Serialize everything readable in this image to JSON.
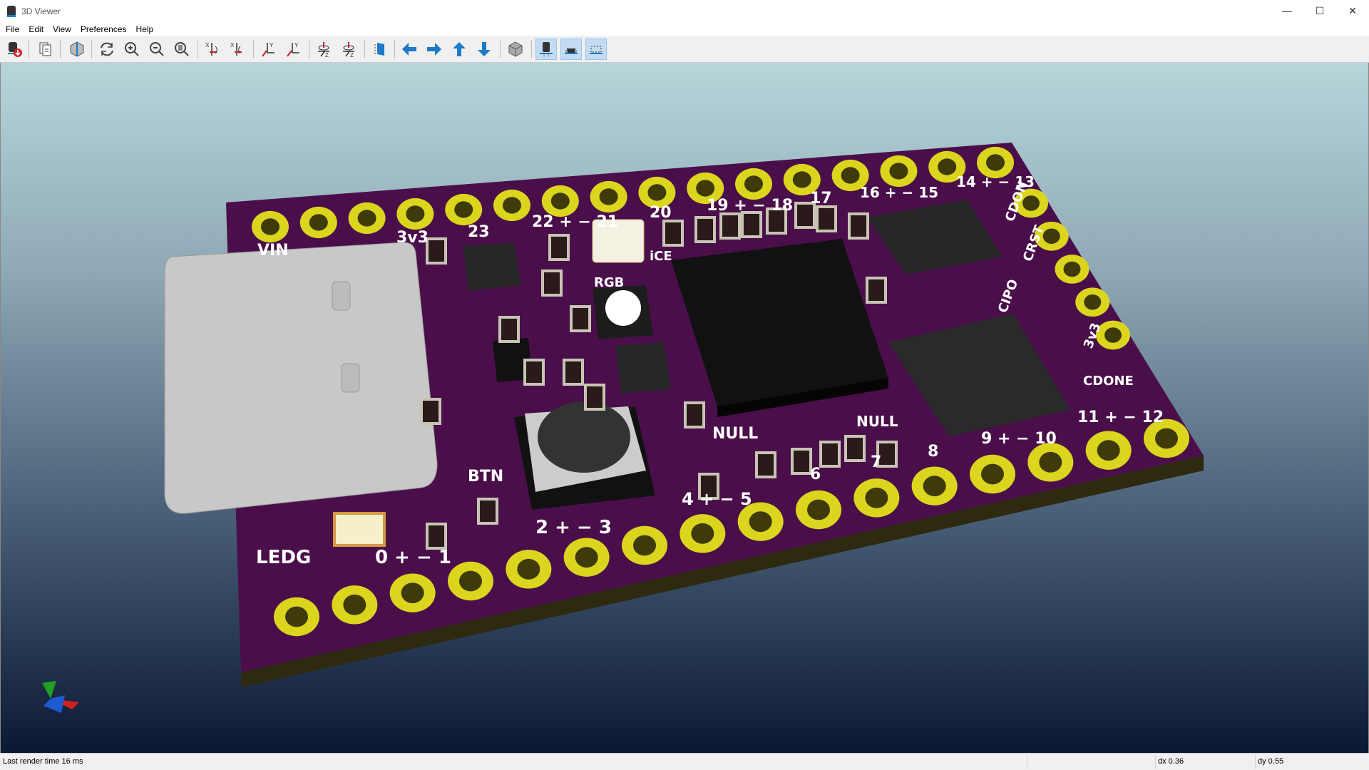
{
  "window": {
    "title": "3D Viewer",
    "controls": [
      "minimize",
      "maximize",
      "close"
    ]
  },
  "menu": [
    "File",
    "Edit",
    "View",
    "Preferences",
    "Help"
  ],
  "toolbar": [
    {
      "icon": "export-icon",
      "label": "Export"
    },
    {
      "icon": "copy-icon",
      "label": "Copy"
    },
    {
      "icon": "render-options-icon",
      "label": "Raytracing"
    },
    {
      "icon": "reload-icon",
      "label": "Reload"
    },
    {
      "icon": "zoom-in-icon",
      "label": "Zoom in"
    },
    {
      "icon": "zoom-out-icon",
      "label": "Zoom out"
    },
    {
      "icon": "zoom-fit-icon",
      "label": "Zoom to fit"
    },
    {
      "icon": "rotate-x-cw-icon",
      "label": "Rotate X clockwise"
    },
    {
      "icon": "rotate-x-ccw-icon",
      "label": "Rotate X counterclockwise"
    },
    {
      "icon": "rotate-y-cw-icon",
      "label": "Rotate Y clockwise"
    },
    {
      "icon": "rotate-y-ccw-icon",
      "label": "Rotate Y counterclockwise"
    },
    {
      "icon": "rotate-z-cw-icon",
      "label": "Rotate Z clockwise"
    },
    {
      "icon": "rotate-z-ccw-icon",
      "label": "Rotate Z counterclockwise"
    },
    {
      "icon": "flip-board-icon",
      "label": "Flip board"
    },
    {
      "icon": "arrow-left-icon",
      "label": "Pan left"
    },
    {
      "icon": "arrow-right-icon",
      "label": "Pan right"
    },
    {
      "icon": "arrow-up-icon",
      "label": "Pan up"
    },
    {
      "icon": "arrow-down-icon",
      "label": "Pan down"
    },
    {
      "icon": "ortho-icon",
      "label": "Orthographic"
    },
    {
      "icon": "tht-models-icon",
      "label": "Through hole models",
      "active": true
    },
    {
      "icon": "smd-models-icon",
      "label": "SMD models",
      "active": true
    },
    {
      "icon": "virtual-models-icon",
      "label": "Virtual models",
      "active": true
    }
  ],
  "pcb": {
    "colors": {
      "soldermask": "#4a0f4a",
      "copper": "#dbd51e",
      "silkscreen": "#ffffff",
      "background_top": "#b6d6da",
      "background_bottom": "#0b1834"
    },
    "silkscreen": [
      "VIN",
      "3v3",
      "23",
      "22 + − 21",
      "20",
      "19 + − 18",
      "17",
      "16 + − 15",
      "14 + − 13",
      "CDON",
      "CRST",
      "CIPO",
      "3v3",
      "CDONE",
      "11 + − 12",
      "9 + − 10",
      "8",
      "7",
      "6",
      "NULL",
      "NULL",
      "4 + − 5",
      "2 + − 3",
      "BTN",
      "0 + − 1",
      "LEDG",
      "RGB",
      "iCE"
    ]
  },
  "status": {
    "render_time": "Last render time 16 ms",
    "dx": "dx 0.36",
    "dy": "dy 0.55"
  }
}
